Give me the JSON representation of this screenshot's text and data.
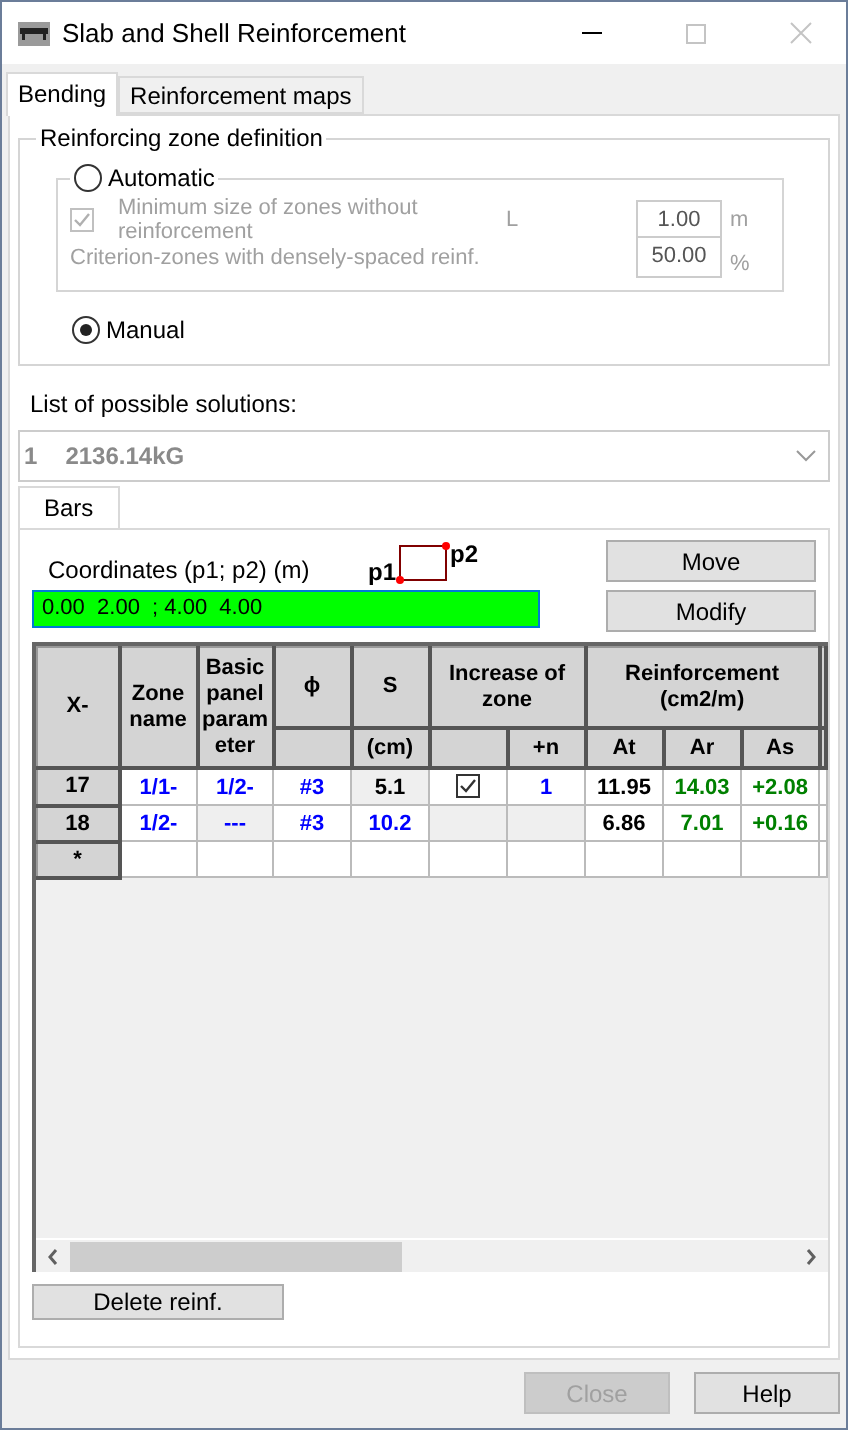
{
  "window": {
    "title": "Slab and Shell Reinforcement"
  },
  "tabs": [
    {
      "label": "Bending",
      "selected": true
    },
    {
      "label": "Reinforcement maps",
      "selected": false
    }
  ],
  "zone_definition": {
    "title": "Reinforcing zone definition",
    "options": [
      {
        "label": "Automatic",
        "selected": false
      },
      {
        "label": "Manual",
        "selected": true
      }
    ],
    "automatic": {
      "disabled": true,
      "min_size": {
        "checked": true,
        "label": "Minimum size of zones without reinforcement",
        "symbol": "L",
        "value": "1.00",
        "unit": "m"
      },
      "criterion": {
        "label": "Criterion-zones with densely-spaced reinf.",
        "value": "50.00",
        "unit": "%"
      }
    }
  },
  "solutions": {
    "label": "List of possible solutions:",
    "index": "1",
    "value": "2136.14kG",
    "disabled": true
  },
  "inner_tabs": [
    {
      "label": "Bars",
      "selected": true
    }
  ],
  "coordinates": {
    "label": "Coordinates (p1; p2) (m)",
    "p1": "p1",
    "p2": "p2",
    "value": "0.00  2.00  ; 4.00  4.00"
  },
  "side_buttons": [
    "Move",
    "Modify"
  ],
  "grid": {
    "columns": [
      {
        "label": "X-"
      },
      {
        "label": "Zone name"
      },
      {
        "label": "Basic panel parameter"
      },
      {
        "label": "ϕ",
        "leading_blank": true
      },
      {
        "label": "S",
        "subs": [
          "(cm)"
        ]
      },
      {
        "label": "Increase of zone",
        "leading_blank": true,
        "subs": [
          "+n"
        ]
      },
      {
        "label": "Reinforcement (cm2/m)",
        "subs": [
          "At",
          "Ar",
          "As"
        ]
      }
    ],
    "rows": [
      {
        "header": "17",
        "cells": [
          {
            "text": "1/1-",
            "color": "#0000ff"
          },
          {
            "text": "1/2-",
            "color": "#0000ff"
          },
          {
            "text": "#3",
            "color": "#0000ff"
          },
          {
            "text": "5.1",
            "color": "#000000",
            "disabled": true
          },
          {
            "kind": "check",
            "checked": true
          },
          {
            "text": "1",
            "color": "#0000ff"
          },
          {
            "text": "11.95",
            "color": "#000000"
          },
          {
            "text": "14.03",
            "color": "#008000"
          },
          {
            "text": "+2.08",
            "color": "#008000"
          }
        ]
      },
      {
        "header": "18",
        "cells": [
          {
            "text": "1/2-",
            "color": "#0000ff"
          },
          {
            "text": "---",
            "color": "#0000ff",
            "disabled": true
          },
          {
            "text": "#3",
            "color": "#0000ff"
          },
          {
            "text": "10.2",
            "color": "#0000ff"
          },
          {
            "disabled": true
          },
          {
            "disabled": true
          },
          {
            "text": "6.86",
            "color": "#000000"
          },
          {
            "text": "7.01",
            "color": "#008000"
          },
          {
            "text": "+0.16",
            "color": "#008000"
          }
        ]
      },
      {
        "header": "*"
      }
    ]
  },
  "delete_button": "Delete reinf.",
  "footer_buttons": [
    {
      "label": "Close",
      "disabled": true
    },
    {
      "label": "Help",
      "disabled": false
    }
  ]
}
